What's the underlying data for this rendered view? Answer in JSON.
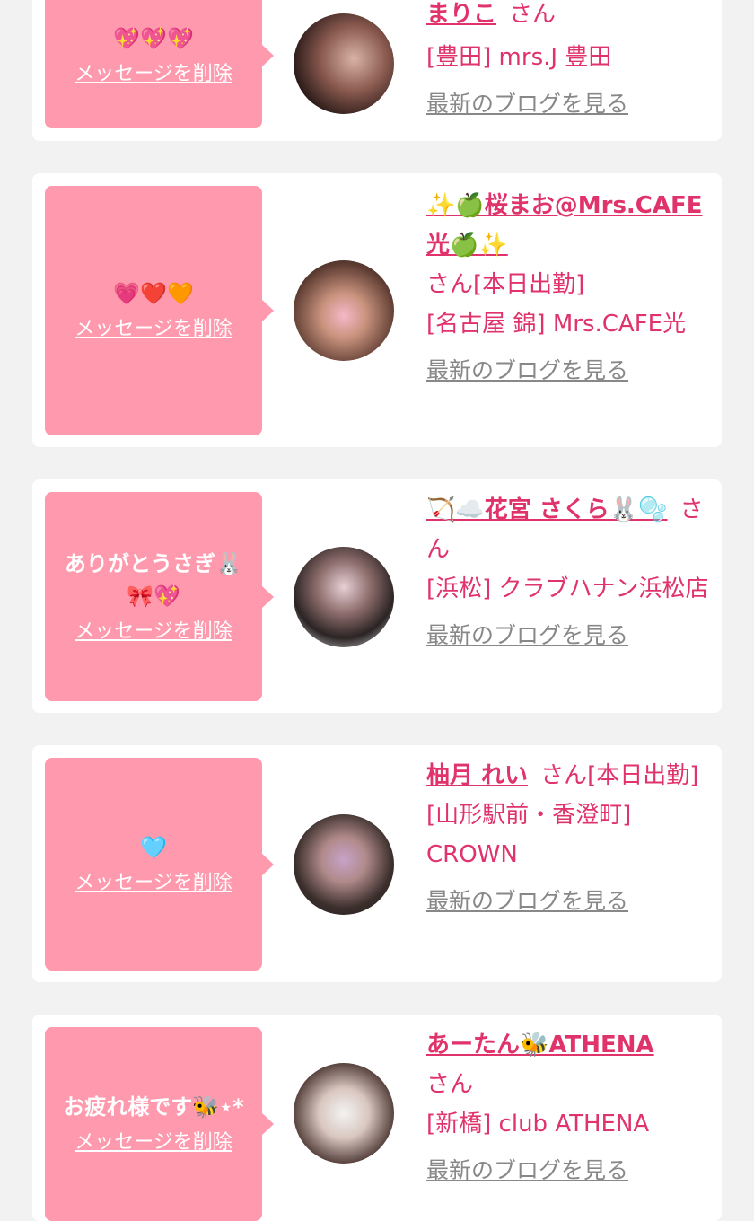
{
  "delete_label": "メッセージを削除",
  "blog_label": "最新のブログを見る",
  "san": "さん",
  "colors": {
    "accent": "#e0336b",
    "bubble": "#ff99ad",
    "card": "#ffffff",
    "background": "#f2f2f2",
    "link_gray": "#888888"
  },
  "items": [
    {
      "message": "💖💖💖",
      "name": "まりこ",
      "status": "",
      "shop": "[豊田] mrs.J 豊田"
    },
    {
      "message": "💗❤️🧡",
      "name": "✨🍏桜まお@Mrs.CAFE光🍏✨",
      "status": "[本日出勤]",
      "shop": "[名古屋 錦] Mrs.CAFE光"
    },
    {
      "message": "ありがとうさぎ🐰🎀💖",
      "name": "🏹☁️花宮 さくら🐰🫧",
      "status": "",
      "shop": "[浜松] クラブハナン浜松店"
    },
    {
      "message": "🩵",
      "name": "柚月 れい",
      "status": "[本日出勤]",
      "shop": "[山形駅前・香澄町] CROWN"
    },
    {
      "message": "お疲れ様です🐝⋆*",
      "name": "あーたん🐝ATHENA",
      "status": "",
      "shop": "[新橋] club ATHENA"
    }
  ]
}
